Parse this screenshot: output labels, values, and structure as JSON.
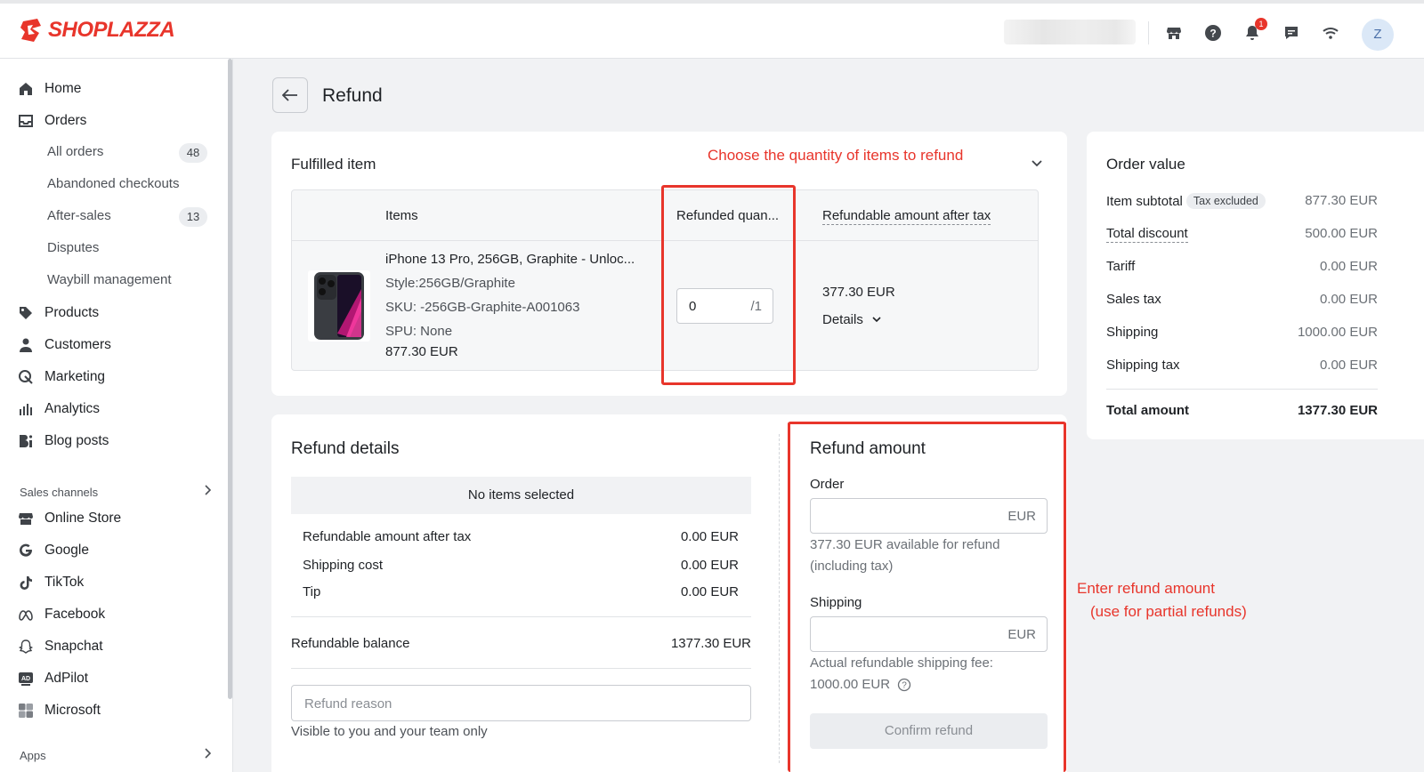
{
  "brand": {
    "name": "SHOPLAZZA",
    "accent": "#e8352b"
  },
  "topbar": {
    "icons": [
      "store-icon",
      "help-icon",
      "bell-icon",
      "chat-icon",
      "wifi-icon"
    ],
    "notification_count": "1",
    "avatar_initial": "Z"
  },
  "sidebar": {
    "items": [
      {
        "label": "Home",
        "icon": "home-icon"
      },
      {
        "label": "Orders",
        "icon": "orders-icon"
      },
      {
        "label": "Products",
        "icon": "tag-icon"
      },
      {
        "label": "Customers",
        "icon": "user-icon"
      },
      {
        "label": "Marketing",
        "icon": "marketing-icon"
      },
      {
        "label": "Analytics",
        "icon": "analytics-icon"
      },
      {
        "label": "Blog posts",
        "icon": "blog-icon"
      }
    ],
    "order_subitems": [
      {
        "label": "All orders",
        "badge": "48"
      },
      {
        "label": "Abandoned checkouts",
        "badge": ""
      },
      {
        "label": "After-sales",
        "badge": "13"
      },
      {
        "label": "Disputes",
        "badge": ""
      },
      {
        "label": "Waybill management",
        "badge": ""
      }
    ],
    "sales_channels_label": "Sales channels",
    "channels": [
      {
        "label": "Online Store",
        "icon": "store-icon"
      },
      {
        "label": "Google",
        "icon": "google-icon"
      },
      {
        "label": "TikTok",
        "icon": "tiktok-icon"
      },
      {
        "label": "Facebook",
        "icon": "meta-icon"
      },
      {
        "label": "Snapchat",
        "icon": "snapchat-icon"
      },
      {
        "label": "AdPilot",
        "icon": "adpilot-icon"
      },
      {
        "label": "Microsoft",
        "icon": "microsoft-icon"
      }
    ],
    "apps_label": "Apps"
  },
  "page": {
    "title": "Refund"
  },
  "fulfilled": {
    "title": "Fulfilled item",
    "headers": {
      "items": "Items",
      "qty": "Refunded quan...",
      "amount": "Refundable amount after tax"
    },
    "product": {
      "name": "iPhone 13 Pro, 256GB, Graphite - Unloc...",
      "style": "Style:256GB/Graphite",
      "sku": "SKU: -256GB-Graphite-A001063",
      "spu": "SPU: None",
      "price": "877.30 EUR"
    },
    "qty_value": "0",
    "qty_max": "/1",
    "refundable_amount": "377.30 EUR",
    "details_label": "Details"
  },
  "refund_details": {
    "title": "Refund details",
    "no_items": "No items selected",
    "rows": [
      {
        "label": "Refundable amount after tax",
        "value": "0.00 EUR"
      },
      {
        "label": "Shipping cost",
        "value": "0.00 EUR"
      },
      {
        "label": "Tip",
        "value": "0.00 EUR"
      }
    ],
    "balance_label": "Refundable balance",
    "balance_value": "1377.30 EUR",
    "reason_placeholder": "Refund reason",
    "reason_hint": "Visible to you and your team only"
  },
  "refund_amount": {
    "title": "Refund amount",
    "order_label": "Order",
    "currency": "EUR",
    "order_hint_1": "377.30 EUR available for refund",
    "order_hint_2": "(including tax)",
    "shipping_label": "Shipping",
    "shipping_hint_1": "Actual refundable shipping fee:",
    "shipping_hint_2": "1000.00 EUR",
    "confirm_label": "Confirm refund"
  },
  "order_value": {
    "title": "Order value",
    "tax_tag": "Tax excluded",
    "rows": [
      {
        "label": "Item subtotal",
        "value": "877.30 EUR"
      },
      {
        "label": "Total discount",
        "value": "500.00 EUR"
      },
      {
        "label": "Tariff",
        "value": "0.00 EUR"
      },
      {
        "label": "Sales tax",
        "value": "0.00 EUR"
      },
      {
        "label": "Shipping",
        "value": "1000.00 EUR"
      },
      {
        "label": "Shipping tax",
        "value": "0.00 EUR"
      }
    ],
    "total_label": "Total amount",
    "total_value": "1377.30 EUR"
  },
  "annotations": {
    "quantity": "Choose the quantity of items to refund",
    "amount_1": "Enter refund amount",
    "amount_2": "(use for partial refunds)"
  }
}
